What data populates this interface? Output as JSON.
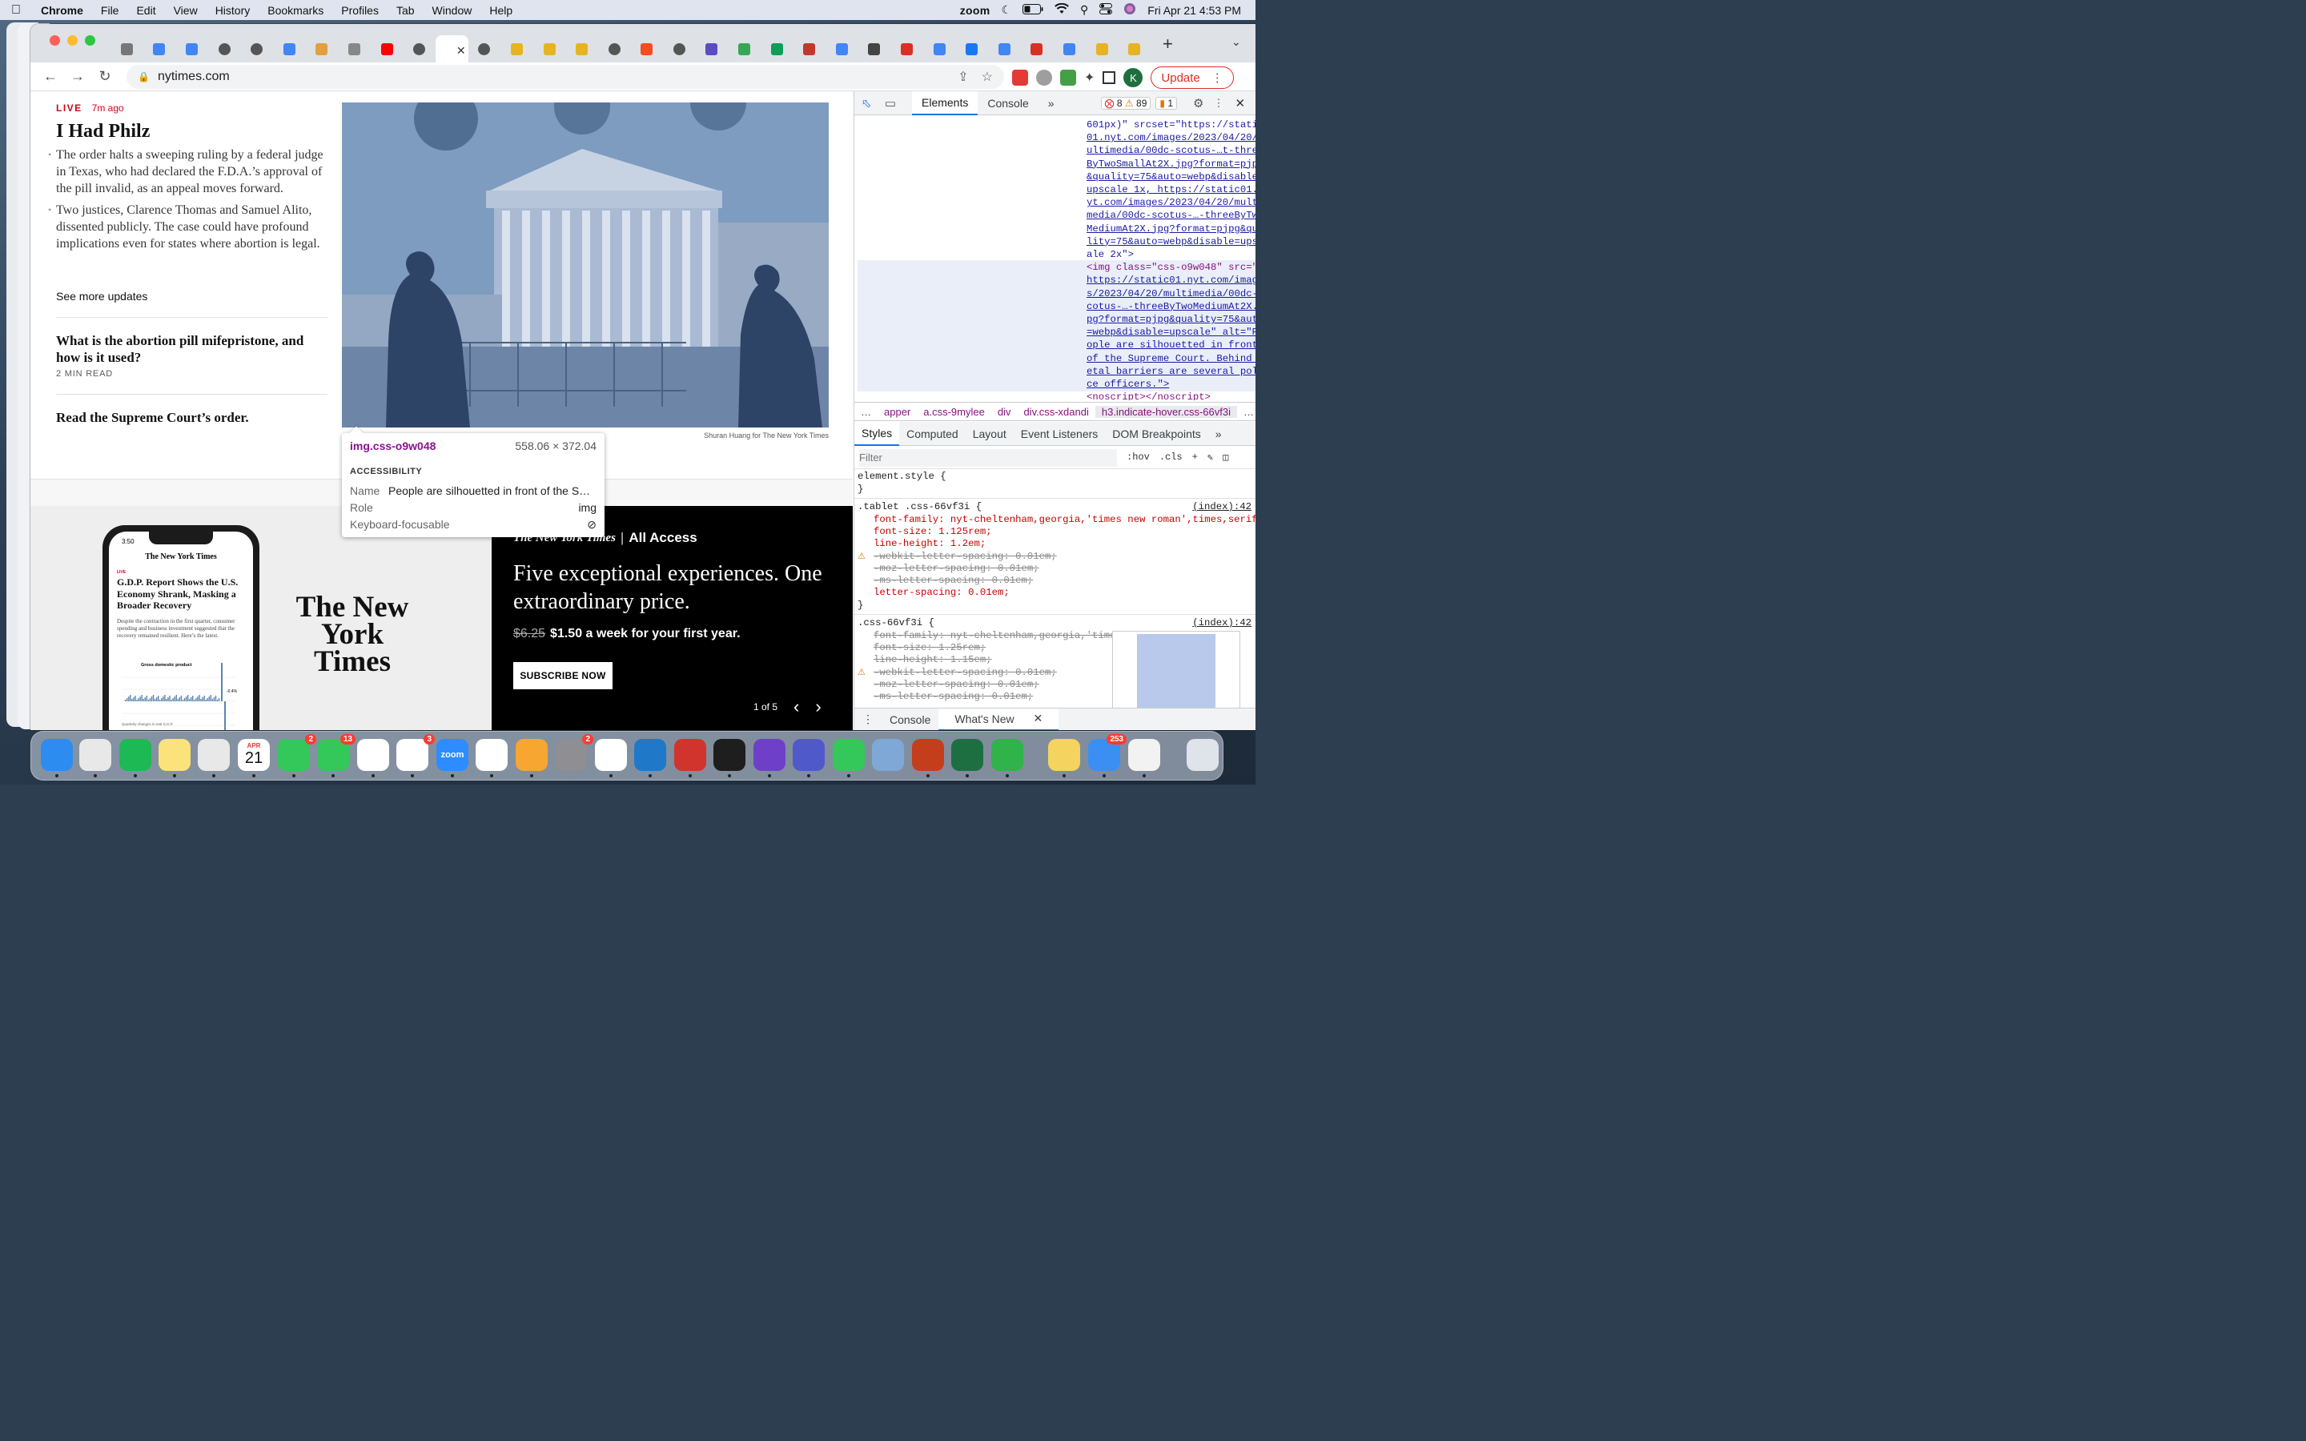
{
  "menubar": {
    "app": "Chrome",
    "items": [
      "File",
      "Edit",
      "View",
      "History",
      "Bookmarks",
      "Profiles",
      "Tab",
      "Window",
      "Help"
    ],
    "zoom_label": "zoom",
    "datetime": "Fri Apr 21  4:53 PM"
  },
  "browser": {
    "url": "nytimes.com",
    "update_label": "Update",
    "profile_initial": "K",
    "tab_colors": [
      "#777",
      "#4285f4",
      "#4285f4",
      "#555",
      "#555",
      "#4285f4",
      "#e0a040",
      "#888",
      "#ff0000",
      "#555",
      "#fff",
      "#555",
      "#e6b422",
      "#e6b422",
      "#e6b422",
      "#555",
      "#f24e1e",
      "#555",
      "#5b4bc4",
      "#34a853",
      "#0f9d58",
      "#c0392b",
      "#4285f4",
      "#444",
      "#d93025",
      "#4285f4",
      "#1877f2",
      "#4285f4",
      "#d93025",
      "#4285f4",
      "#e6b422",
      "#e6b422"
    ]
  },
  "article": {
    "live_label": "LIVE",
    "live_time": "7m ago",
    "headline": "I Had Philz",
    "bullets": [
      "The order halts a sweeping ruling by a federal judge in Texas, who had declared the F.D.A.’s approval of the pill invalid, as an appeal moves forward.",
      "Two justices, Clarence Thomas and Samuel Alito, dissented publicly. The case could have profound implications even for states where abortion is legal."
    ],
    "see_more": "See more updates",
    "sub1_title": "What is the abortion pill mifepristone, and how is it used?",
    "sub1_meta": "2 MIN READ",
    "sub2_title": "Read the Supreme Court’s order.",
    "photo_credit": "Shuran Huang for The New York Times"
  },
  "tooltip": {
    "selector": "img.css-o9w048",
    "size": "558.06 × 372.04",
    "section": "ACCESSIBILITY",
    "name_label": "Name",
    "name_value": "People are silhouetted in front of the S…",
    "role_label": "Role",
    "role_value": "img",
    "focus_label": "Keyboard-focusable"
  },
  "promo": {
    "phone_time": "3:50",
    "phone_logo": "The New York Times",
    "phone_live": "LIVE",
    "phone_headline": "G.D.P. Report Shows the U.S. Economy Shrank, Masking a Broader Recovery",
    "phone_body": "Despite the contraction in the first quarter, consumer spending and business investment suggested that the recovery remained resilient. Here’s the latest.",
    "phone_chart_title": "Gross domestic product",
    "phone_chart_value": "-0.4%",
    "phone_chart_caption": "Quarterly changes in real G.D.P.",
    "nyt_logo": "The New York Times",
    "aa_brand": "The New York Times",
    "aa_label": "All Access",
    "tagline": "Five exceptional experiences. One extraordinary price.",
    "old_price": "$6.25",
    "new_price": "$1.50 a week for your first year.",
    "subscribe": "SUBSCRIBE NOW",
    "pager": "1 of 5"
  },
  "devtools": {
    "tabs": [
      "Elements",
      "Console"
    ],
    "errors": "8",
    "warnings": "89",
    "issues": "1",
    "dom_lines": [
      "601px)\" srcset=\"https://stati",
      "01.nyt.com/images/2023/04/20/r",
      "ultimedia/00dc-scotus-…t-thre",
      "ByTwoSmallAt2X.jpg?format=pjp",
      "&quality=75&auto=webp&disable",
      "upscale 1x, https://static01.n",
      "yt.com/images/2023/04/20/mult",
      "media/00dc-scotus-…-threeByTw",
      "MediumAt2X.jpg?format=pjpg&qu",
      "lity=75&auto=webp&disable=upsc",
      "ale 2x\">",
      "<img class=\"css-o9w048\" src=\"",
      "https://static01.nyt.com/image",
      "s/2023/04/20/multimedia/00dc-",
      "cotus-…-threeByTwoMediumAt2X.",
      "pg?format=pjpg&quality=75&auto",
      "=webp&disable=upscale\" alt=\"Pe",
      "ople are silhouetted in front",
      "of the Supreme Court. Behind m",
      "etal barriers are several poli",
      "ce officers.\">",
      "<noscript></noscript>"
    ],
    "breadcrumbs": [
      "…",
      "apper",
      "a.css-9mylee",
      "div",
      "div.css-xdandi",
      "h3.indicate-hover.css-66vf3i",
      "…"
    ],
    "subtabs": [
      "Styles",
      "Computed",
      "Layout",
      "Event Listeners",
      "DOM Breakpoints",
      "»"
    ],
    "filter_placeholder": "Filter",
    "hov": ":hov",
    "cls": ".cls",
    "styles": [
      "element.style {",
      "}",
      ".tablet .css-66vf3i {",
      "font-family: nyt-cheltenham,georgia,'times new roman',times,serif;",
      "font-size: 1.125rem;",
      "line-height: 1.2em;",
      "-webkit-letter-spacing: 0.01em;",
      "-moz-letter-spacing: 0.01em;",
      "-ms-letter-spacing: 0.01em;",
      "letter-spacing: 0.01em;",
      "}",
      ".css-66vf3i {",
      "font-family: nyt-cheltenham,georgia,'times",
      "font-size: 1.25rem;",
      "line-height: 1.15em;",
      "-webkit-letter-spacing: 0.01em;",
      "-moz-letter-spacing: 0.01em;",
      "-ms-letter-spacing: 0.01em;"
    ],
    "source_ref": "(index):42",
    "drawer_tabs": [
      "Console",
      "What's New"
    ]
  },
  "dock": {
    "calendar_month": "APR",
    "calendar_day": "21",
    "zoom_label": "zoom",
    "badges": {
      "facetime": "2",
      "messages": "13",
      "photos": "3",
      "settings": "2",
      "mail": "253"
    }
  }
}
